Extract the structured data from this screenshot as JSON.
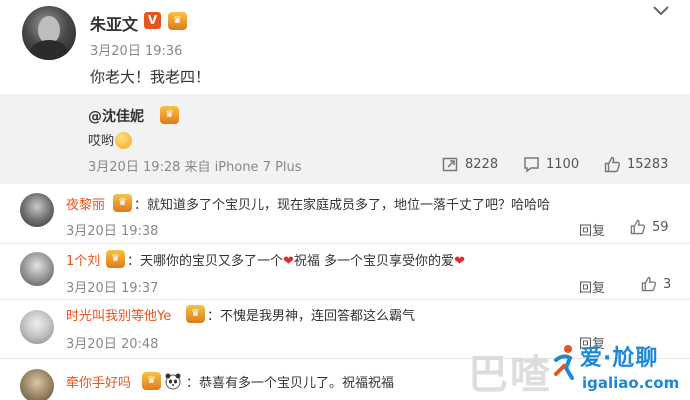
{
  "post": {
    "author": "朱亚文",
    "vip_badge": "V",
    "time": "3月20日 19:36",
    "text": "你老大！我老四！",
    "repost": {
      "author": "@沈佳妮",
      "text": "哎哟",
      "meta": "3月20日 19:28 来自 iPhone 7 Plus",
      "reposts": "8228",
      "comments": "1100",
      "likes": "15283"
    }
  },
  "comments": [
    {
      "name": "夜黎丽",
      "text": "：就知道多了个宝贝儿，现在家庭成员多了，地位一落千丈了吧？哈哈哈",
      "time": "3月20日 19:38",
      "reply": "回复",
      "likes": "59"
    },
    {
      "name": "1个刘",
      "text_a": "：天哪你的宝贝又多了一个",
      "text_b": "祝福 多一个宝贝享受你的爱",
      "time": "3月20日 19:37",
      "reply": "回复",
      "likes": "3"
    },
    {
      "name": "时光叫我别等他Ye",
      "text": "：不愧是我男神，连回答都这么霸气",
      "time": "3月20日 20:48",
      "reply": "回复"
    },
    {
      "name": "牵你手好吗",
      "text": "：恭喜有多一个宝贝儿了。祝福祝福"
    }
  ],
  "watermark": {
    "cn": "巴喳",
    "title": "爱·尬聊",
    "url": "igaliao.com"
  },
  "colors": {
    "accent": "#e8541e",
    "link_blue": "#1e88d6",
    "repost_bg": "#f2f2f2"
  },
  "icons": [
    "chevron-down-icon",
    "vip-icon",
    "medal-icon",
    "repost-icon",
    "comment-icon",
    "like-icon",
    "heart-icon",
    "panda-icon"
  ]
}
